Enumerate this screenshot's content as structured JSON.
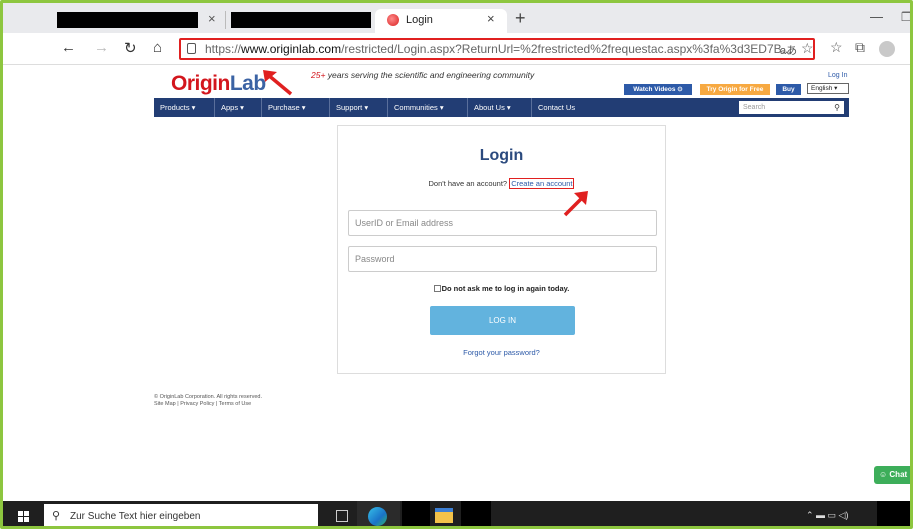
{
  "browser": {
    "tabs": [
      {
        "label": "",
        "redacted": true
      },
      {
        "label": "",
        "redacted": true
      },
      {
        "label": "Login",
        "active": true
      }
    ],
    "url_domain_prefix": "https://",
    "url_domain": "www.originlab.com",
    "url_path": "/restricted/Login.aspx?ReturnUrl=%2frestricted%2frequestac.aspx%3fa%3d3ED7B...",
    "reader_glyph": "aあ",
    "highlight_color": "#e02020"
  },
  "site": {
    "logo_origin": "Origin",
    "logo_lab": "Lab",
    "tagline_prefix": "25+",
    "tagline_rest": " years serving the scientific and engineering community",
    "buttons": {
      "watch_videos": "Watch Videos",
      "try_origin": "Try Origin for Free",
      "buy": "Buy",
      "login": "Log In",
      "language": "English"
    },
    "nav": [
      "Products ▾",
      "Apps ▾",
      "Purchase ▾",
      "Support ▾",
      "Communities ▾",
      "About Us ▾",
      "Contact Us"
    ],
    "search_placeholder": "Search",
    "accent_navy": "#223d74",
    "accent_red": "#d3161d"
  },
  "login": {
    "title": "Login",
    "no_account_text": "Don't have an account?",
    "create_link": "Create an account",
    "userid_placeholder": "UserID or Email address",
    "password_placeholder": "Password",
    "remember_label": "Do not ask me to log in again today.",
    "login_button": "LOG IN",
    "forgot_link": "Forgot your password?"
  },
  "footer": {
    "copyright": "© OriginLab Corporation. All rights reserved.",
    "links": "Site Map | Privacy Policy | Terms of Use"
  },
  "chat": {
    "label": "Chat"
  },
  "taskbar": {
    "search_text": "Zur Suche Text hier eingeben"
  }
}
